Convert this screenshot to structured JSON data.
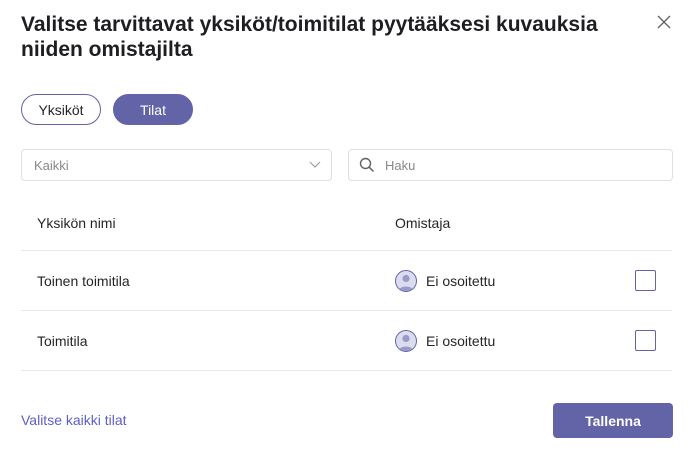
{
  "dialog": {
    "title": "Valitse tarvittavat yksiköt/toimitilat pyytääksesi kuvauksia niiden omistajilta"
  },
  "tabs": [
    {
      "label": "Yksiköt",
      "active": false
    },
    {
      "label": "Tilat",
      "active": true
    }
  ],
  "filter": {
    "value": "Kaikki"
  },
  "search": {
    "placeholder": "Haku",
    "value": ""
  },
  "table": {
    "headers": {
      "name": "Yksikön nimi",
      "owner": "Omistaja"
    },
    "rows": [
      {
        "name": "Toinen toimitila",
        "owner": "Ei osoitettu",
        "checked": false
      },
      {
        "name": "Toimitila",
        "owner": "Ei osoitettu",
        "checked": false
      }
    ]
  },
  "footer": {
    "select_all_label": "Valitse kaikki tilat",
    "save_label": "Tallenna"
  },
  "icons": {
    "close": "close-icon",
    "dropdown": "chevron-down-icon",
    "search": "search-icon",
    "avatar": "user-avatar-icon"
  },
  "colors": {
    "accent": "#6264a7",
    "link": "#5b5fc7",
    "border": "#e1dfdd"
  }
}
